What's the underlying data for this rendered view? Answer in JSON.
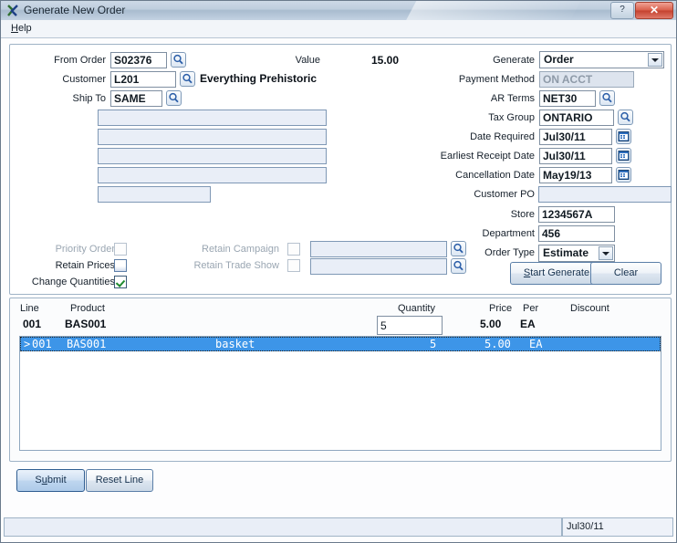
{
  "window": {
    "title": "Generate New Order",
    "app_icon": "app-icon",
    "help_button": "?",
    "close_button": "✕"
  },
  "menubar": {
    "items": [
      {
        "label_pre": "",
        "accel": "H",
        "label_post": "elp",
        "name": "menu-help"
      }
    ]
  },
  "header": {
    "from_order": {
      "label": "From Order",
      "value": "S02376"
    },
    "customer": {
      "label": "Customer",
      "value": "L201",
      "name_text": "Everything Prehistoric"
    },
    "ship_to": {
      "label": "Ship To",
      "value": "SAME"
    },
    "address_lines": [
      "",
      "",
      "",
      ""
    ],
    "postal_line": "",
    "value": {
      "label": "Value",
      "amount": "15.00"
    },
    "generate": {
      "label": "Generate",
      "value": "Order"
    },
    "payment_method": {
      "label": "Payment Method",
      "value": "ON ACCT"
    },
    "ar_terms": {
      "label": "AR Terms",
      "value": "NET30"
    },
    "tax_group": {
      "label": "Tax Group",
      "value": "ONTARIO"
    },
    "date_required": {
      "label": "Date Required",
      "value": "Jul30/11"
    },
    "earliest_receipt_date": {
      "label": "Earliest Receipt Date",
      "value": "Jul30/11"
    },
    "cancellation_date": {
      "label": "Cancellation Date",
      "value": "May19/13"
    },
    "customer_po": {
      "label": "Customer PO",
      "value": ""
    },
    "store": {
      "label": "Store",
      "value": "1234567A"
    },
    "department": {
      "label": "Department",
      "value": "456"
    },
    "order_type": {
      "label": "Order Type",
      "value": "Estimate"
    }
  },
  "options": {
    "priority_order": {
      "label": "Priority Order",
      "checked": false,
      "enabled": false
    },
    "retain_prices": {
      "label": "Retain Prices",
      "checked": false,
      "enabled": true
    },
    "change_quantities": {
      "label": "Change Quantities",
      "checked": true,
      "enabled": true
    },
    "retain_campaign": {
      "label": "Retain Campaign",
      "checked": false,
      "enabled": false,
      "field_value": ""
    },
    "retain_trade_show": {
      "label": "Retain Trade Show",
      "checked": false,
      "enabled": false,
      "field_value": ""
    }
  },
  "actions": {
    "start_generate": {
      "accel": "S",
      "label_post": "tart Generate"
    },
    "clear": "Clear",
    "submit": {
      "label_pre": "S",
      "accel": "u",
      "label_post": "bmit"
    },
    "reset_line": "Reset Line"
  },
  "grid": {
    "headers": {
      "line": "Line",
      "product": "Product",
      "quantity": "Quantity",
      "price": "Price",
      "per": "Per",
      "discount": "Discount"
    },
    "entry_row": {
      "line": "001",
      "product": "BAS001",
      "quantity": "5",
      "price": "5.00",
      "per": "EA",
      "discount": ""
    },
    "rows": [
      {
        "marker": ">",
        "line": "001",
        "product": "BAS001",
        "description": "basket",
        "quantity": "5",
        "price": "5.00",
        "per": "EA",
        "selected": true
      }
    ]
  },
  "statusbar": {
    "main": "",
    "date": "Jul30/11"
  },
  "colors": {
    "selection_blue": "#3d95e8",
    "title_gradient_top": "#cdd9e6",
    "close_red": "#d9604c",
    "check_green": "#1e8a2e",
    "field_empty_bg": "#e9eef7"
  }
}
